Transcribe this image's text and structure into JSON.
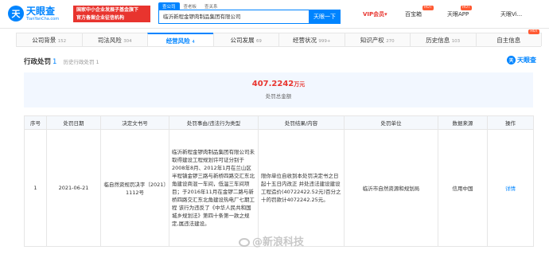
{
  "header": {
    "logo_mark": "天",
    "logo_cn": "天眼查",
    "logo_en": "TianYanCha.com",
    "promo_line1": "国家中小企业发展子基金旗下",
    "promo_line2": "官方备案企业征信机构",
    "search_tabs": [
      "查公司",
      "查老板",
      "查关系"
    ],
    "search_value": "临沂新程金锣肉制品集团有限公司",
    "search_button": "天眼一下",
    "vip": "VIP会员",
    "vip_arrow": "▾",
    "baodian": "百宝箱",
    "app": "天眼APP",
    "user": "天眼Vi...",
    "hot_badge": "HOT"
  },
  "tabs_row1": [
    {
      "label": "公司背景",
      "count": "152"
    },
    {
      "label": "司法风险",
      "count": "304"
    },
    {
      "label": "经营风险",
      "count": "4",
      "active": true
    },
    {
      "label": "公司发展",
      "count": "69"
    },
    {
      "label": "经营状况",
      "count": "999+"
    },
    {
      "label": "知识产权",
      "count": "270"
    },
    {
      "label": "历史信息",
      "count": "103"
    },
    {
      "label": "自主信息",
      "count": ""
    }
  ],
  "section": {
    "title": "行政处罚",
    "count": "1",
    "history": "历史行政处罚 1"
  },
  "watermark": {
    "mark": "天",
    "text": "天眼查"
  },
  "summary": {
    "amount": "407.2242",
    "unit": "万元",
    "label": "处罚总金额"
  },
  "table": {
    "headers": [
      "序号",
      "处罚日期",
      "决定文书号",
      "处罚事由/违法行为类型",
      "处罚结果/内容",
      "处罚单位",
      "数据来源",
      "操作"
    ],
    "rows": [
      {
        "index": "1",
        "date": "2021-06-21",
        "doc_no": "临自然资规罚决字〔2021〕1112号",
        "reason": "临沂新程金锣肉制品集团有限公司未取得建设工程规划许可证分别于2008年8月、2012年1月在兰山区半程镇金锣三路与新桥四路交汇东北角建设商混一车间，低温三车间项目；于2016年11月在金锣二路与新桥四路交汇东北角建设热电厂七期工程 该行为违反了《中华人民共和国城乡规划法》第四十条第一款之规定,属违法建设。",
        "result": "限你单位自收到本处罚决定书之日起十五日内改正 并处违法建设建设工程造价(40722422.52元)百分之十的罚款计4072242.25元。",
        "unit": "临沂市自然资源和规划局",
        "source": "信用中国",
        "action": "详情"
      }
    ]
  },
  "bottom_watermark": "@新浪科技"
}
